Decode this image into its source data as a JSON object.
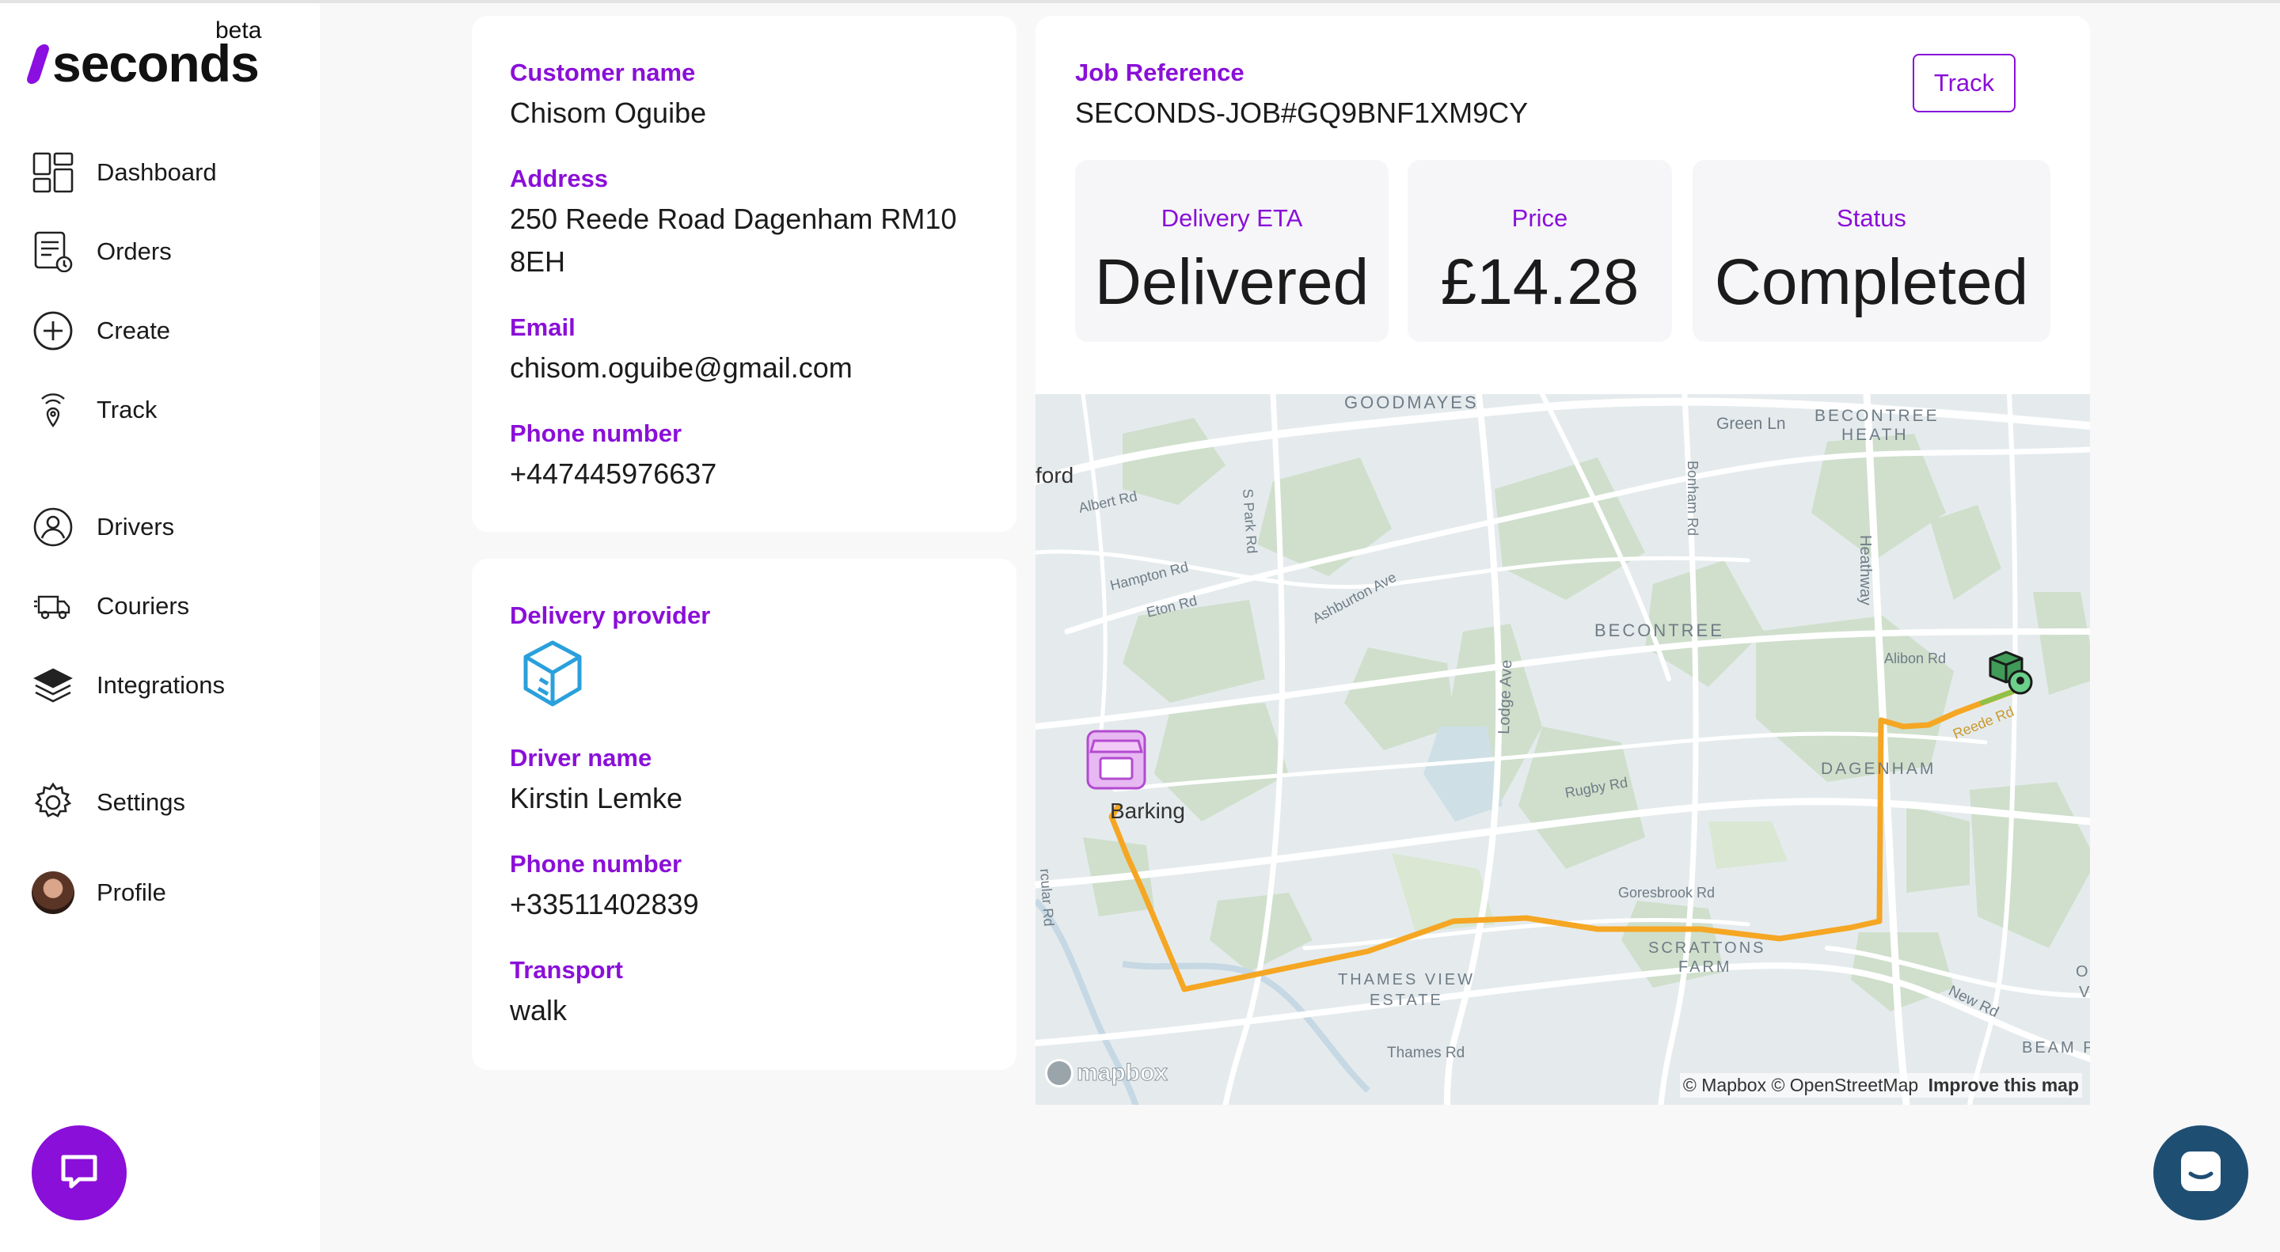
{
  "brand": {
    "name": "seconds",
    "badge": "beta",
    "accent": "#8a0fd8"
  },
  "sidebar": {
    "items": [
      {
        "label": "Dashboard",
        "icon": "dashboard-icon"
      },
      {
        "label": "Orders",
        "icon": "orders-icon"
      },
      {
        "label": "Create",
        "icon": "plus-circle-icon"
      },
      {
        "label": "Track",
        "icon": "location-signal-icon"
      },
      {
        "label": "Drivers",
        "icon": "driver-icon"
      },
      {
        "label": "Couriers",
        "icon": "truck-icon"
      },
      {
        "label": "Integrations",
        "icon": "layers-icon"
      },
      {
        "label": "Settings",
        "icon": "gear-icon"
      },
      {
        "label": "Profile",
        "icon": "avatar"
      }
    ]
  },
  "customer": {
    "name_label": "Customer name",
    "name": "Chisom Oguibe",
    "address_label": "Address",
    "address_line1": "250 Reede Road Dagenham RM10",
    "address_line2": "8EH",
    "email_label": "Email",
    "email": "chisom.oguibe@gmail.com",
    "phone_label": "Phone number",
    "phone": "+447445976637"
  },
  "delivery": {
    "provider_label": "Delivery provider",
    "provider_icon": "box-provider-icon",
    "driver_label": "Driver name",
    "driver": "Kirstin Lemke",
    "phone_label": "Phone number",
    "phone": "+33511402839",
    "transport_label": "Transport",
    "transport": "walk"
  },
  "job": {
    "ref_label": "Job Reference",
    "ref": "SECONDS-JOB#GQ9BNF1XM9CY",
    "track_label": "Track",
    "eta_label": "Delivery ETA",
    "eta": "Delivered",
    "price_label": "Price",
    "price": "£14.28",
    "status_label": "Status",
    "status": "Completed"
  },
  "map": {
    "places": {
      "goodmayes": "GOODMAYES",
      "ilford": "ford",
      "green_ln": "Green Ln",
      "becontree_heath_1": "BECONTREE",
      "becontree_heath_2": "HEATH",
      "albert_rd": "Albert Rd",
      "s_park_rd": "S Park Rd",
      "bonham_rd": "Bonham Rd",
      "heathway": "Heathway",
      "hampton_rd": "Hampton Rd",
      "eton_rd": "Eton Rd",
      "ashburton_ave": "Ashburton Ave",
      "becontree": "BECONTREE",
      "alibon_rd": "Alibon Rd",
      "reede_rd": "Reede Rd",
      "lodge_ave": "Lodge Ave",
      "dagenham": "DAGENHAM",
      "barking": "Barking",
      "rugby_rd": "Rugby Rd",
      "circular_rd": "rcular Rd",
      "goresbrook_rd": "Goresbrook Rd",
      "scrattons_1": "SCRATTONS",
      "scrattons_2": "FARM",
      "thames_view_1": "THAMES VIEW",
      "thames_view_2": "ESTATE",
      "thames_rd": "Thames Rd",
      "new_rd": "New Rd",
      "beam_p": "BEAM P",
      "edge_o": "O",
      "edge_v": "V"
    },
    "logo": "mapbox",
    "attribution": "© Mapbox © OpenStreetMap",
    "improve": "Improve this map",
    "route_color": "#f5a623"
  }
}
